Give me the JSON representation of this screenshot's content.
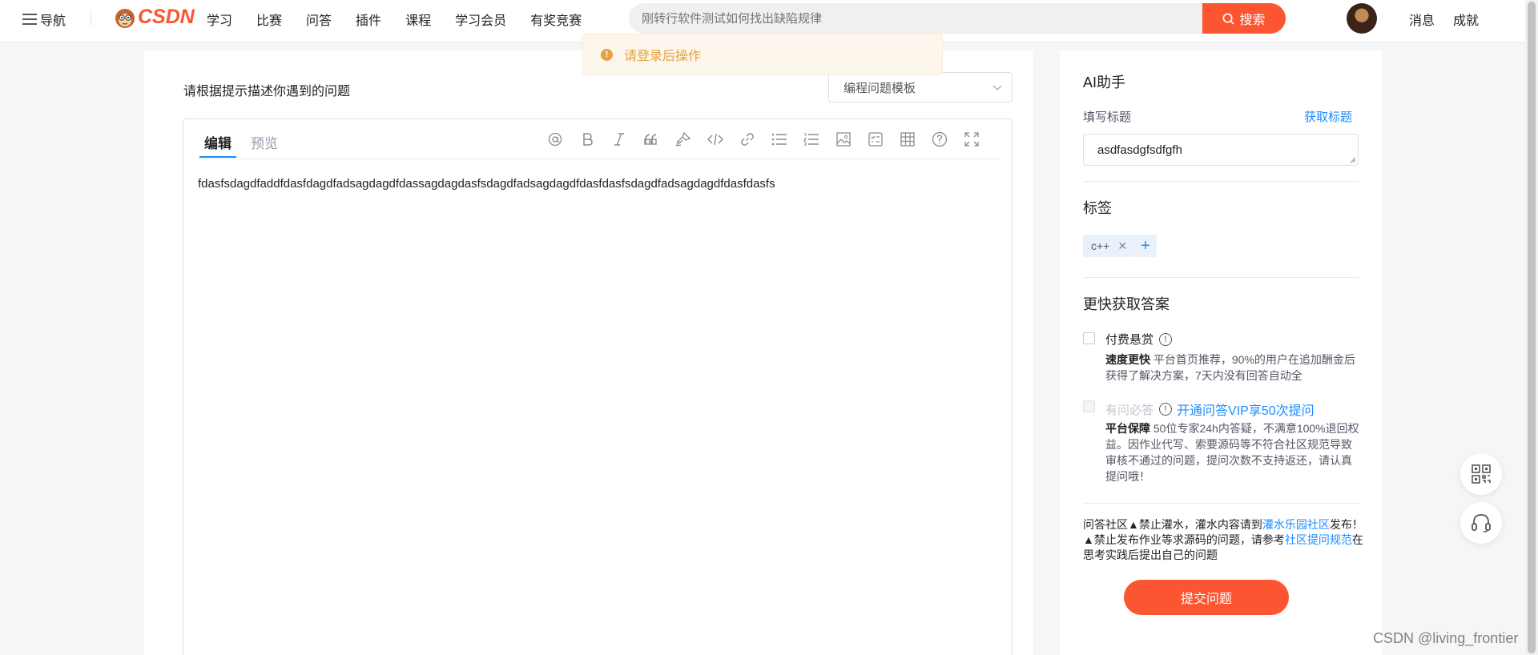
{
  "topbar": {
    "nav_label": "导航",
    "logo_text": "CSDN",
    "menu": [
      "学习",
      "比赛",
      "问答",
      "插件",
      "课程",
      "学习会员",
      "有奖竞赛"
    ],
    "search_placeholder": "刚转行软件测试如何找出缺陷规律",
    "search_button": "搜索",
    "links": [
      "消息",
      "成就"
    ]
  },
  "toast": {
    "message": "请登录后操作"
  },
  "editor": {
    "prompt_label": "请根据提示描述你遇到的问题",
    "template_select": "编程问题模板",
    "tabs": [
      "编辑",
      "预览"
    ],
    "toolbar_icons": [
      "mention-icon",
      "bold-icon",
      "italic-icon",
      "quote-icon",
      "brush-icon",
      "code-icon",
      "link-icon",
      "bullet-list-icon",
      "ordered-list-icon",
      "image-icon",
      "checklist-icon",
      "table-icon",
      "help-icon",
      "fullscreen-icon"
    ],
    "content": "fdasfsdagdfaddfdasfdagdfadsagdagdfdassagdagdasfsdagdfadsagdagdfdasfdasfsdagdfadsagdagdfdasfdasfs"
  },
  "sidebar": {
    "ai_title": "AI助手",
    "title_label": "填写标题",
    "get_title_link": "获取标题",
    "title_value": "asdfasdgfsdfgfh",
    "tags_title": "标签",
    "tags": [
      "c++"
    ],
    "faster_title": "更快获取答案",
    "option1": {
      "label": "付费悬赏",
      "desc_bold": "速度更快",
      "desc": " 平台首页推荐，90%的用户在追加酬金后获得了解决方案，7天内没有回答自动全"
    },
    "option2": {
      "label": "有问必答",
      "link": "开通问答VIP享50次提问",
      "desc_bold": "平台保障",
      "desc": " 50位专家24h内答疑，不满意100%退回权益。因作业代写、索要源码等不符合社区规范导致审核不通过的问题，提问次数不支持返还，请认真提问哦！"
    },
    "notice_part1": "问答社区▲禁止灌水，灌水内容请到",
    "notice_link1": "灌水乐园社区",
    "notice_part2": "发布！▲禁止发布作业等求源码的问题，请参考",
    "notice_link2": "社区提问规范",
    "notice_part3": "在思考实践后提出自己的问题",
    "submit": "提交问题"
  },
  "watermark": "CSDN @living_frontier",
  "colors": {
    "brand": "#fc5531",
    "link": "#1a8cff",
    "warning": "#e6a23c"
  }
}
